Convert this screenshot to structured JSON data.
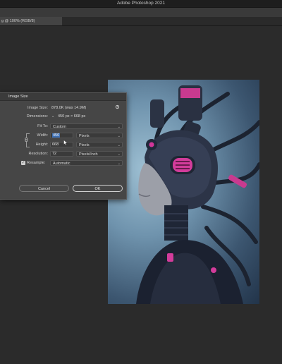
{
  "app": {
    "title": "Adobe Photoshop 2021"
  },
  "document": {
    "tab_label": "g @ 100% (RGB/8)"
  },
  "dialog": {
    "title": "Image Size",
    "image_size_label": "Image Size:",
    "image_size_value": "878.0K (was 14.9M)",
    "dimensions_label": "Dimensions:",
    "dimensions_value": "450 px  ×  668 px",
    "fit_to_label": "Fit To:",
    "fit_to_value": "Custom",
    "width_label": "Width:",
    "width_value": "450",
    "width_unit": "Pixels",
    "height_label": "Height:",
    "height_value": "668",
    "height_unit": "Pixels",
    "resolution_label": "Resolution:",
    "resolution_value": "72",
    "resolution_unit": "Pixels/Inch",
    "resample_label": "Resample:",
    "resample_checked": true,
    "resample_value": "Automatic",
    "cancel_label": "Cancel",
    "ok_label": "OK"
  },
  "icons": {
    "gear": "gear-icon",
    "link": "link-icon",
    "check": "✓",
    "chevron": "⌄"
  },
  "colors": {
    "accent_selection": "#3d6fb3",
    "artwork_magenta": "#e0409f"
  }
}
